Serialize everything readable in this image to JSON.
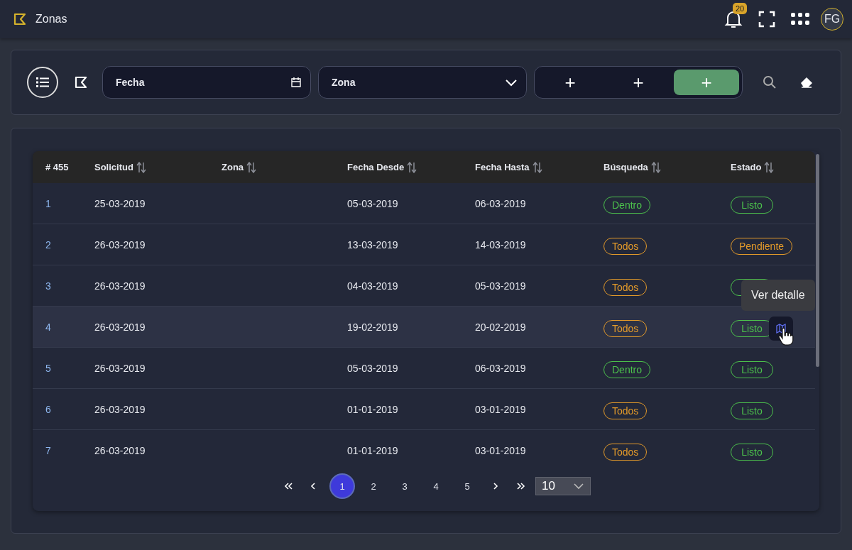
{
  "header": {
    "title": "Zonas",
    "notifications": "20",
    "avatar": "FG"
  },
  "filters": {
    "date_field": {
      "placeholder": "Fecha"
    },
    "zone_select": {
      "placeholder": "Zona"
    },
    "add_buttons": [
      {
        "label": "+",
        "selected": false
      },
      {
        "label": "+",
        "selected": false
      },
      {
        "label": "+",
        "selected": true
      }
    ]
  },
  "table": {
    "count": "# 455",
    "columns": [
      "Solicitud",
      "Zona",
      "Fecha Desde",
      "Fecha Hasta",
      "Búsqueda",
      "Estado"
    ],
    "rows": [
      {
        "id": "1",
        "solicitud": "25-03-2019",
        "fecha_desde": "05-03-2019",
        "fecha_hasta": "06-03-2019",
        "busqueda": {
          "label": "Dentro",
          "color": "#4cc24c"
        },
        "estado": {
          "label": "Listo",
          "color": "#4cc24c"
        },
        "hovered": false
      },
      {
        "id": "2",
        "solicitud": "26-03-2019",
        "fecha_desde": "13-03-2019",
        "fecha_hasta": "14-03-2019",
        "busqueda": {
          "label": "Todos",
          "color": "#e39a2a"
        },
        "estado": {
          "label": "Pendiente",
          "color": "#e39a2a"
        },
        "hovered": false
      },
      {
        "id": "3",
        "solicitud": "26-03-2019",
        "fecha_desde": "04-03-2019",
        "fecha_hasta": "05-03-2019",
        "busqueda": {
          "label": "Todos",
          "color": "#e39a2a"
        },
        "estado": {
          "color": "#4cc24c"
        },
        "hovered": false
      },
      {
        "id": "4",
        "solicitud": "26-03-2019",
        "fecha_desde": "19-02-2019",
        "fecha_hasta": "20-02-2019",
        "busqueda": {
          "label": "Todos",
          "color": "#e39a2a"
        },
        "estado": {
          "label": "Listo",
          "color": "#4cc24c"
        },
        "hovered": true,
        "tooltip": "Ver detalle"
      },
      {
        "id": "5",
        "solicitud": "26-03-2019",
        "fecha_desde": "05-03-2019",
        "fecha_hasta": "06-03-2019",
        "busqueda": {
          "label": "Dentro",
          "color": "#4cc24c"
        },
        "estado": {
          "label": "Listo",
          "color": "#4cc24c"
        },
        "hovered": false
      },
      {
        "id": "6",
        "solicitud": "26-03-2019",
        "fecha_desde": "01-01-2019",
        "fecha_hasta": "03-01-2019",
        "busqueda": {
          "label": "Todos",
          "color": "#e39a2a"
        },
        "estado": {
          "label": "Listo",
          "color": "#4cc24c"
        },
        "hovered": false
      },
      {
        "id": "7",
        "solicitud": "26-03-2019",
        "fecha_desde": "01-01-2019",
        "fecha_hasta": "03-01-2019",
        "busqueda": {
          "label": "Todos",
          "color": "#e39a2a"
        },
        "estado": {
          "label": "Listo",
          "color": "#4cc24c"
        },
        "hovered": false
      }
    ]
  },
  "pager": {
    "pages": [
      {
        "label": "1",
        "selected": true
      },
      {
        "label": "2",
        "selected": false
      },
      {
        "label": "3",
        "selected": false
      },
      {
        "label": "4",
        "selected": false
      },
      {
        "label": "5",
        "selected": false
      }
    ],
    "page_size": "10"
  }
}
